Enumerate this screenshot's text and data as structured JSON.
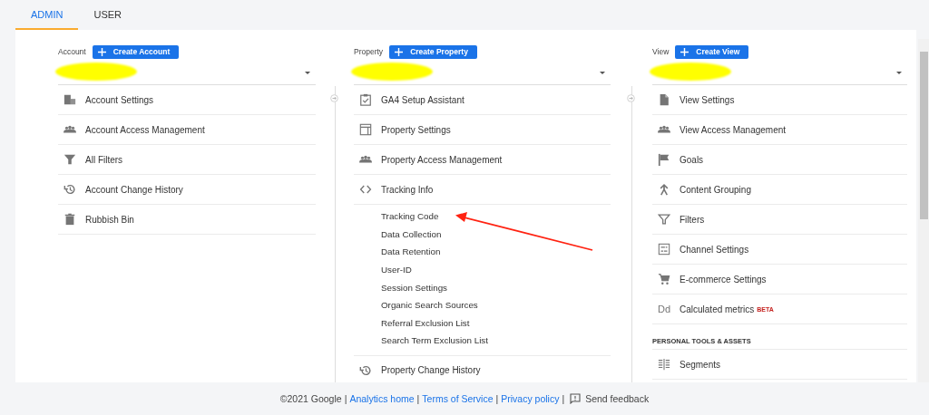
{
  "tabs": [
    {
      "label": "ADMIN",
      "selected": true
    },
    {
      "label": "USER",
      "selected": false
    }
  ],
  "columns": [
    {
      "label": "Account",
      "create_button": "Create Account",
      "items": [
        {
          "kind": "item",
          "label": "Account Settings"
        },
        {
          "kind": "item",
          "label": "Account Access Management"
        },
        {
          "kind": "item",
          "label": "All Filters"
        },
        {
          "kind": "item",
          "label": "Account Change History"
        },
        {
          "kind": "item",
          "label": "Rubbish Bin"
        }
      ]
    },
    {
      "label": "Property",
      "create_button": "Create Property",
      "items": [
        {
          "kind": "item",
          "label": "GA4 Setup Assistant"
        },
        {
          "kind": "item",
          "label": "Property Settings"
        },
        {
          "kind": "item",
          "label": "Property Access Management"
        },
        {
          "kind": "item",
          "label": "Tracking Info",
          "children": [
            {
              "label": "Tracking Code"
            },
            {
              "label": "Data Collection"
            },
            {
              "label": "Data Retention"
            },
            {
              "label": "User-ID"
            },
            {
              "label": "Session Settings"
            },
            {
              "label": "Organic Search Sources"
            },
            {
              "label": "Referral Exclusion List"
            },
            {
              "label": "Search Term Exclusion List"
            }
          ]
        },
        {
          "kind": "item",
          "label": "Property Change History"
        }
      ]
    },
    {
      "label": "View",
      "create_button": "Create View",
      "items": [
        {
          "kind": "item",
          "label": "View Settings"
        },
        {
          "kind": "item",
          "label": "View Access Management"
        },
        {
          "kind": "item",
          "label": "Goals"
        },
        {
          "kind": "item",
          "label": "Content Grouping"
        },
        {
          "kind": "item",
          "label": "Filters"
        },
        {
          "kind": "item",
          "label": "Channel Settings"
        },
        {
          "kind": "item",
          "label": "E-commerce Settings"
        },
        {
          "kind": "item",
          "label": "Calculated metrics",
          "icon_text": "Dd",
          "badge": "BETA"
        },
        {
          "kind": "section",
          "label": "PERSONAL TOOLS & ASSETS"
        },
        {
          "kind": "item",
          "label": "Segments"
        }
      ]
    }
  ],
  "footer": [
    {
      "kind": "text",
      "text": "©2021 Google"
    },
    {
      "kind": "separator",
      "text": "|"
    },
    {
      "kind": "link",
      "text": "Analytics home"
    },
    {
      "kind": "separator",
      "text": "|"
    },
    {
      "kind": "link",
      "text": "Terms of Service"
    },
    {
      "kind": "separator",
      "text": "|"
    },
    {
      "kind": "link",
      "text": "Privacy policy"
    },
    {
      "kind": "separator",
      "text": "|"
    },
    {
      "kind": "feedback",
      "text": "Send feedback"
    }
  ]
}
